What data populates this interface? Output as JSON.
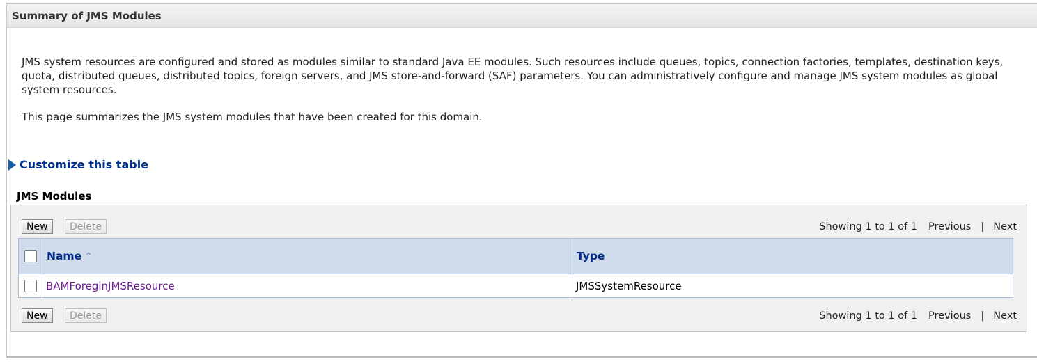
{
  "header": {
    "title": "Summary of JMS Modules"
  },
  "description": {
    "paragraph1": "JMS system resources are configured and stored as modules similar to standard Java EE modules. Such resources include queues, topics, connection factories, templates, destination keys, quota, distributed queues, distributed topics, foreign servers, and JMS store-and-forward (SAF) parameters. You can administratively configure and manage JMS system modules as global system resources.",
    "paragraph2": "This page summarizes the JMS system modules that have been created for this domain."
  },
  "customize": {
    "label": "Customize this table"
  },
  "table": {
    "title": "JMS Modules",
    "new_label": "New",
    "delete_label": "Delete",
    "paging": {
      "showing": "Showing 1 to 1 of 1",
      "previous": "Previous",
      "separator": "|",
      "next": "Next"
    },
    "columns": {
      "name": "Name",
      "type": "Type"
    },
    "rows": [
      {
        "name": "BAMForeginJMSResource",
        "type": "JMSSystemResource"
      }
    ]
  }
}
